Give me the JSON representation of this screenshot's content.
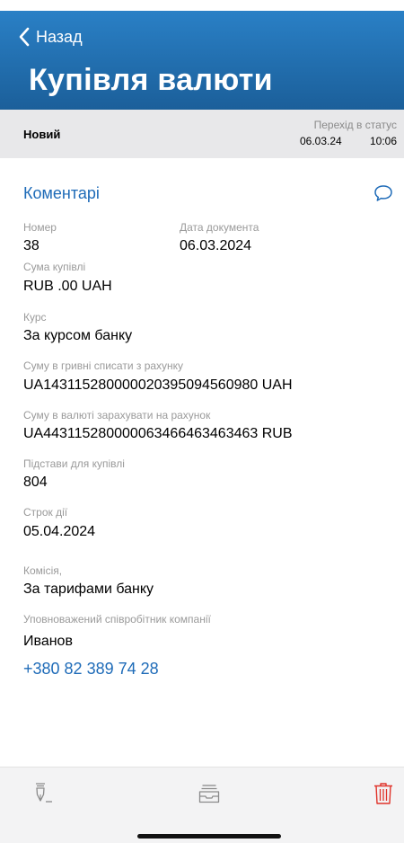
{
  "header": {
    "back_label": "Назад",
    "title": "Купівля валюти"
  },
  "status": {
    "name": "Новий",
    "transition_label": "Перехід в статус",
    "date": "06.03.24",
    "time": "10:06"
  },
  "comments": {
    "label": "Коментарі",
    "icon": "speech-bubble-icon"
  },
  "fields": {
    "number_label": "Номер",
    "number": "38",
    "doc_date_label": "Дата документа",
    "doc_date": "06.03.2024",
    "amount_label": "Сума купівлі",
    "amount": "RUB .00 UAH",
    "rate_label": "Курс",
    "rate": "За курсом банку",
    "debit_label": "Суму в гривні списати з рахунку",
    "debit": "UA143115280000020395094560980 UAH",
    "credit_label": "Суму в валюті зарахувати на рахунок",
    "credit": "UA443115280000063466463463463 RUB",
    "basis_label": "Підстави для купівлі",
    "basis": "804",
    "term_label": "Строк дії",
    "term": "05.04.2024",
    "fee_label": "Комісія,",
    "fee": "За тарифами банку",
    "employee_label": "Уповноважений співробітник компанії",
    "employee": "Иванов",
    "phone": "+380 82 389 74 28"
  },
  "toolbar": {
    "sign_icon": "pen-sign-icon",
    "archive_icon": "inbox-tray-icon",
    "delete_icon": "trash-icon"
  },
  "colors": {
    "header_top": "#2a80c6",
    "header_bottom": "#1b5f9a",
    "link": "#1e6bb8",
    "delete": "#e0332a",
    "status_bg": "#e8e8ea"
  }
}
